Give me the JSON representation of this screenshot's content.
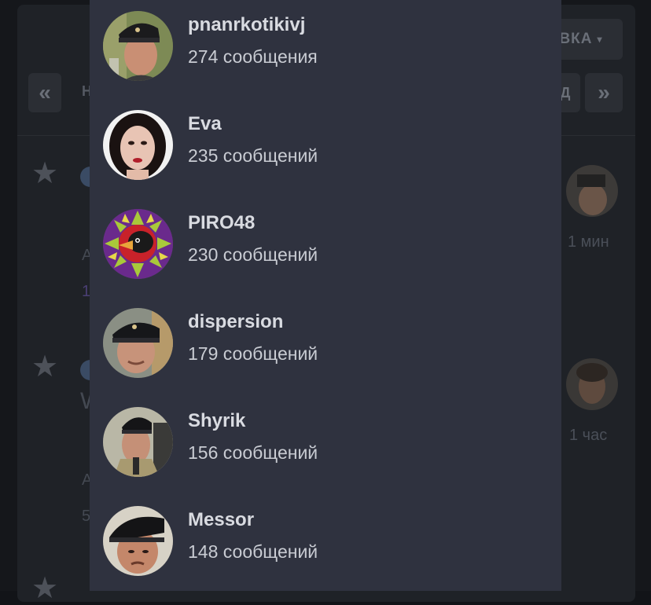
{
  "background": {
    "sort_button": {
      "label": "ВКА",
      "caret": "▾"
    },
    "pagination": {
      "first": "«",
      "first_label": "Н",
      "partial": "Д",
      "last": "»"
    },
    "rows": [
      {
        "star": "★",
        "author_initial": "А",
        "number": "1",
        "time": "1 мин"
      },
      {
        "star": "★",
        "title_fragment": "W",
        "author_initial": "А",
        "number": "5",
        "time": "1 час"
      },
      {
        "star": "★"
      }
    ]
  },
  "users": [
    {
      "name": "pnanrkotikivj",
      "count": "274 сообщения",
      "avatar_icon": "gendarme-avatar-icon"
    },
    {
      "name": "Eva",
      "count": "235 сообщений",
      "avatar_icon": "woman-portrait-avatar-icon"
    },
    {
      "name": "PIRO48",
      "count": "230 сообщений",
      "avatar_icon": "bird-mandala-avatar-icon"
    },
    {
      "name": "dispersion",
      "count": "179 сообщений",
      "avatar_icon": "gendarme-avatar-icon"
    },
    {
      "name": "Shyrik",
      "count": "156 сообщений",
      "avatar_icon": "gendarme-avatar-icon"
    },
    {
      "name": "Messor",
      "count": "148 сообщений",
      "avatar_icon": "gendarme-avatar-icon"
    }
  ],
  "colors": {
    "panel_bg": "#2f323f",
    "page_bg": "#15171b",
    "name_text": "#d9dbe1",
    "count_text": "#c9ccd3"
  }
}
